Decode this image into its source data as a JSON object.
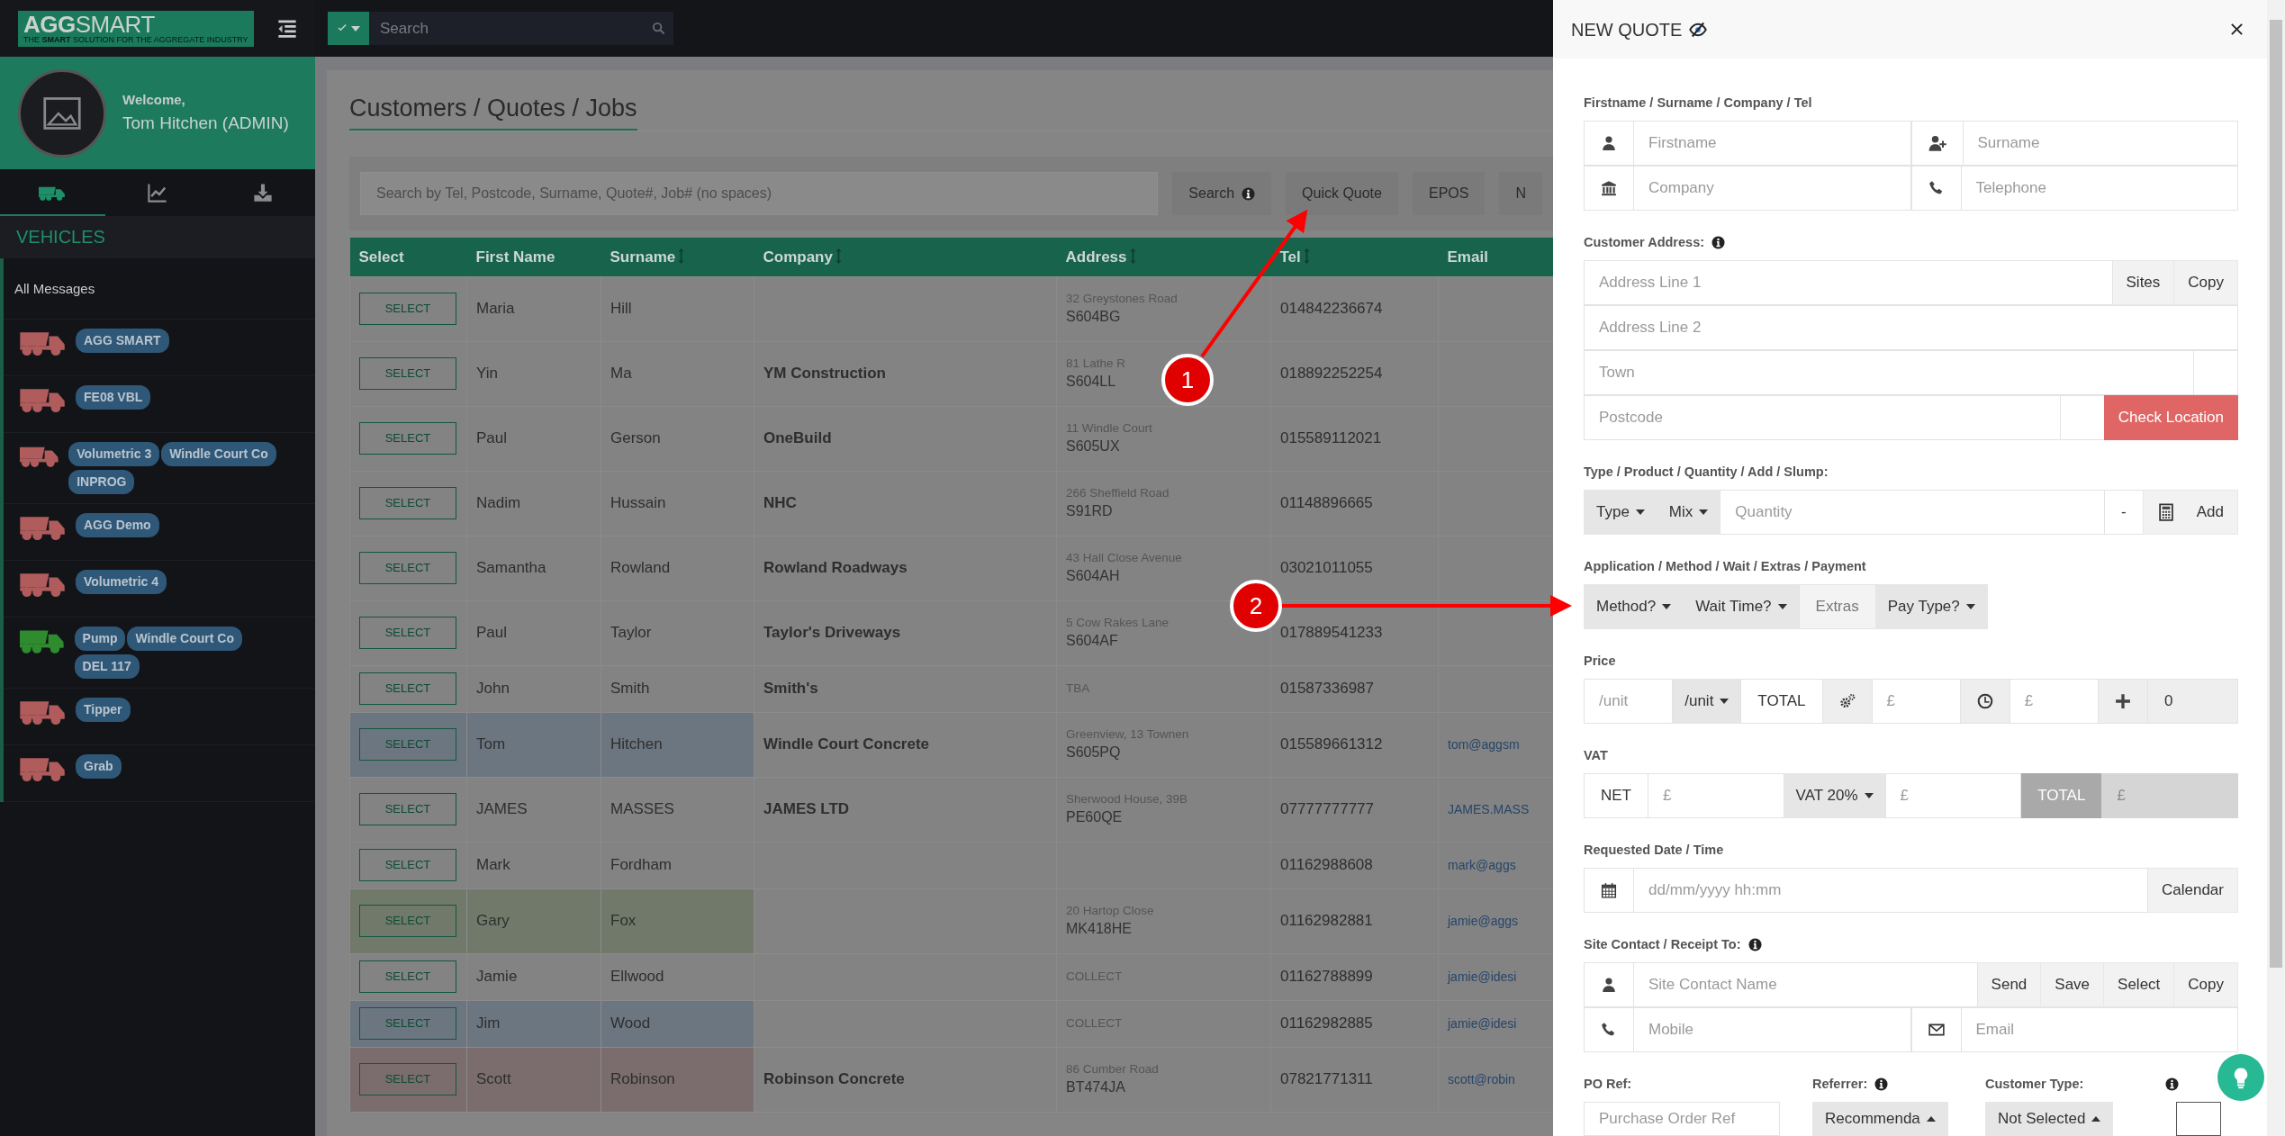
{
  "app": {
    "logo": "**AGG**SMART",
    "tagline": "THE **SMART** SOLUTION FOR THE AGGREGATE INDUSTRY",
    "search": {
      "placeholder": "Search"
    }
  },
  "profile": {
    "greeting": "Welcome,",
    "name": "Tom Hitchen (ADMIN)"
  },
  "sidebar": {
    "tabs": [
      {
        "selected": true
      },
      {
        "selected": false
      },
      {
        "selected": false
      }
    ],
    "section": "VEHICLES",
    "all_messages": "All Messages",
    "vehicles": [
      {
        "color": "#b05c5c",
        "tags": [
          "AGG SMART"
        ]
      },
      {
        "color": "#b05c5c",
        "tags": [
          "FE08 VBL"
        ]
      },
      {
        "color": "#b05c5c",
        "tags": [
          "Volumetric 3",
          "Windle Court Co",
          "INPROG"
        ]
      },
      {
        "color": "#b05c5c",
        "tags": [
          "AGG Demo"
        ]
      },
      {
        "color": "#b05c5c",
        "tags": [
          "Volumetric 4"
        ]
      },
      {
        "color": "#2e8b2e",
        "tags": [
          "Pump",
          "Windle Court Co",
          "DEL 117"
        ]
      },
      {
        "color": "#b05c5c",
        "tags": [
          "Tipper"
        ]
      },
      {
        "color": "#b05c5c",
        "tags": [
          "Grab"
        ]
      }
    ]
  },
  "page": {
    "title": "Customers / Quotes / Jobs",
    "search": {
      "placeholder": "Search by Tel, Postcode, Surname, Quote#, Job# (no spaces)",
      "button": "Search"
    },
    "actions": [
      "Quick Quote",
      "EPOS",
      "N"
    ]
  },
  "table": {
    "columns": [
      {
        "label": "Select",
        "sortable": false
      },
      {
        "label": "First Name",
        "sortable": false
      },
      {
        "label": "Surname",
        "sortable": true
      },
      {
        "label": "Company",
        "sortable": true
      },
      {
        "label": "Address",
        "sortable": true
      },
      {
        "label": "Tel",
        "sortable": true
      },
      {
        "label": "Email",
        "sortable": false
      }
    ],
    "rows": [
      {
        "button": "SELECT",
        "first_name": "Maria",
        "surname": "Hill",
        "address": "32 Greystones Road",
        "postcode": "S604BG",
        "tel": "014842236674"
      },
      {
        "button": "SELECT",
        "first_name": "Yin",
        "surname": "Ma",
        "company": "YM Construction",
        "address": "81 Lathe R",
        "postcode": "S604LL",
        "tel": "018892252254"
      },
      {
        "button": "SELECT",
        "first_name": "Paul",
        "surname": "Gerson",
        "company": "OneBuild",
        "address": "11 Windle Court",
        "postcode": "S605UX",
        "tel": "015589112021"
      },
      {
        "button": "SELECT",
        "first_name": "Nadim",
        "surname": "Hussain",
        "company": "NHC",
        "address": "266 Sheffield Road",
        "postcode": "S91RD",
        "tel": "01148896665"
      },
      {
        "button": "SELECT",
        "first_name": "Samantha",
        "surname": "Rowland",
        "company": "Rowland Roadways",
        "address": "43 Hall Close Avenue",
        "postcode": "S604AH",
        "tel": "03021011055"
      },
      {
        "button": "SELECT",
        "first_name": "Paul",
        "surname": "Taylor",
        "company": "Taylor's Driveways",
        "address": "5 Cow Rakes Lane",
        "postcode": "S604AF",
        "tel": "017889541233"
      },
      {
        "button": "SELECT",
        "first_name": "John",
        "surname": "Smith",
        "company": "Smith's",
        "address": "TBA",
        "tel": "01587336987"
      },
      {
        "button": "SELECT",
        "first_name": "Tom",
        "surname": "Hitchen",
        "company": "Windle Court Concrete",
        "address": "Greenview, 13 Townen",
        "postcode": "S605PQ",
        "tel": "015589661312",
        "email": "tom@aggsm",
        "color": "#6c7680"
      },
      {
        "button": "SELECT",
        "first_name": "JAMES",
        "surname": "MASSES",
        "company": "JAMES LTD",
        "address": "Sherwood House, 39B",
        "postcode": "PE60QE",
        "tel": "07777777777",
        "email": "JAMES.MASS"
      },
      {
        "button": "SELECT",
        "first_name": "Mark",
        "surname": "Fordham",
        "tel": "01162988608",
        "email": "mark@aggs"
      },
      {
        "button": "SELECT",
        "first_name": "Gary",
        "surname": "Fox",
        "address": "20 Hartop Close",
        "postcode": "MK418HE",
        "tel": "01162982881",
        "email": "jamie@aggs",
        "color": "#717a6a"
      },
      {
        "button": "SELECT",
        "first_name": "Jamie",
        "surname": "Ellwood",
        "address": "COLLECT",
        "tel": "01162788899",
        "email": "jamie@idesi"
      },
      {
        "button": "SELECT",
        "first_name": "Jim",
        "surname": "Wood",
        "address": "COLLECT",
        "tel": "01162982885",
        "email": "jamie@idesi",
        "color": "#6c7680"
      },
      {
        "button": "SELECT",
        "first_name": "Scott",
        "surname": "Robinson",
        "company": "Robinson Concrete",
        "address": "86 Cumber Road",
        "postcode": "BT474JA",
        "tel": "07821771311",
        "email": "scott@robin",
        "color": "#7b6d6d"
      }
    ]
  },
  "quote": {
    "title": "NEW QUOTE",
    "customer": {
      "label": "Firstname / Surname / Company / Tel",
      "firstname": {
        "placeholder": "Firstname"
      },
      "surname": {
        "placeholder": "Surname"
      },
      "company": {
        "placeholder": "Company"
      },
      "telephone": {
        "placeholder": "Telephone"
      }
    },
    "address": {
      "label": "Customer Address:",
      "line1": {
        "placeholder": "Address Line 1"
      },
      "buttons": [
        "Sites",
        "Copy"
      ],
      "line2": {
        "placeholder": "Address Line 2"
      },
      "town": {
        "placeholder": "Town"
      },
      "postcode": {
        "placeholder": "Postcode"
      },
      "check_button": "Check Location"
    },
    "product": {
      "label": "Type / Product / Quantity / Add / Slump:",
      "dropdowns": [
        "Type",
        "Mix"
      ],
      "quantity": {
        "placeholder": "Quantity"
      },
      "slump": "-",
      "add_button": "Add"
    },
    "application": {
      "label": "Application / Method / Wait / Extras / Payment",
      "items": [
        {
          "kind": "dropdown",
          "text": "Method?"
        },
        {
          "kind": "dropdown",
          "text": "Wait Time?"
        },
        {
          "kind": "addon",
          "text": "Extras"
        },
        {
          "kind": "dropdown",
          "text": "Pay Type?"
        }
      ]
    },
    "price": {
      "label": "Price",
      "unit_price": {
        "placeholder": "/unit"
      },
      "unit_dropdown": "/unit",
      "total_label": "TOTAL",
      "field_1": {
        "placeholder": "£"
      },
      "field_2": {
        "placeholder": "£"
      },
      "count": "0"
    },
    "vat": {
      "label": "VAT",
      "net_label": "NET",
      "net": {
        "placeholder": "£"
      },
      "rate_dropdown": "VAT 20%",
      "vat_amount": {
        "placeholder": "£"
      },
      "total_label": "TOTAL",
      "total": {
        "placeholder": "£",
        "disabled": true
      }
    },
    "date": {
      "label": "Requested Date / Time",
      "field": {
        "placeholder": "dd/mm/yyyy hh:mm"
      },
      "button": "Calendar"
    },
    "contact": {
      "label": "Site Contact / Receipt To:",
      "name": {
        "placeholder": "Site Contact Name"
      },
      "buttons": [
        "Send",
        "Save",
        "Select",
        "Copy"
      ],
      "mobile": {
        "placeholder": "Mobile"
      },
      "email": {
        "placeholder": "Email"
      }
    },
    "extra": {
      "po_label": "PO Ref:",
      "po": {
        "placeholder": "Purchase Order Ref"
      },
      "referrer_label": "Referrer:",
      "referrer": "Recommenda",
      "customer_type_label": "Customer Type:",
      "customer_type": "Not Selected"
    }
  },
  "annotations": [
    {
      "number": "1"
    },
    {
      "number": "2"
    }
  ]
}
